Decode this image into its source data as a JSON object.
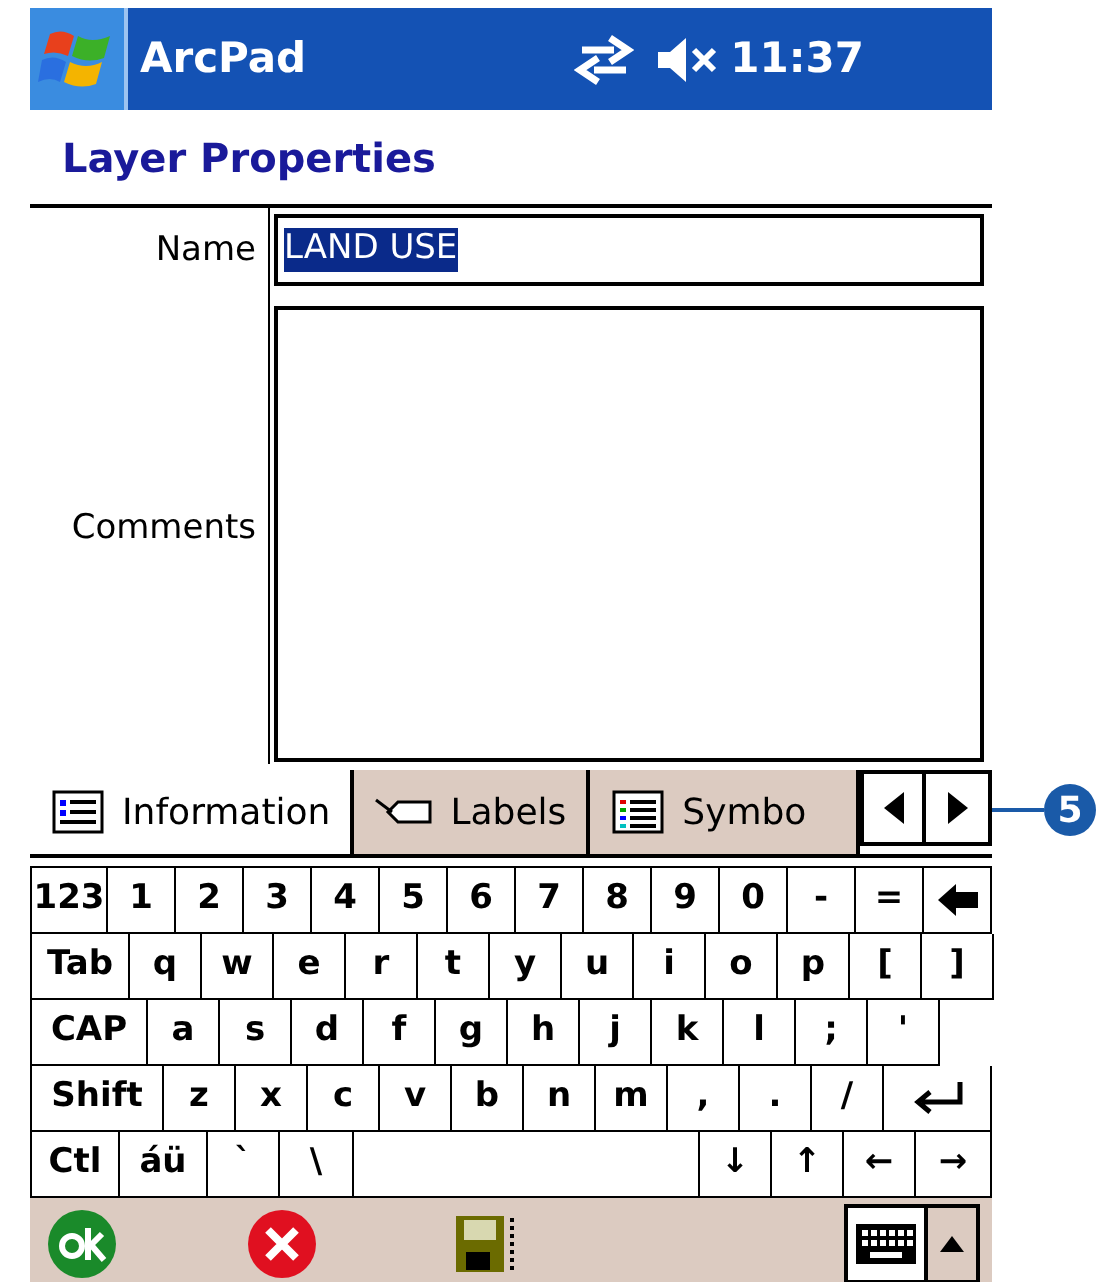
{
  "status_bar": {
    "app": "ArcPad",
    "time": "11:37"
  },
  "title": "Layer Properties",
  "fields": {
    "name_label": "Name",
    "name_value": "LAND USE",
    "name_selected": true,
    "comments_label": "Comments"
  },
  "tabs": [
    {
      "label": "Information",
      "kind": "info",
      "selected": true
    },
    {
      "label": "Labels",
      "kind": "label",
      "selected": false
    },
    {
      "label": "Symbo",
      "kind": "symbology",
      "selected": false
    }
  ],
  "callout": "5",
  "keyboard": [
    [
      {
        "kind": "key",
        "text": "123"
      },
      {
        "kind": "key",
        "text": "1"
      },
      {
        "kind": "key",
        "text": "2"
      },
      {
        "kind": "key",
        "text": "3"
      },
      {
        "kind": "key",
        "text": "4"
      },
      {
        "kind": "key",
        "text": "5"
      },
      {
        "kind": "key",
        "text": "6"
      },
      {
        "kind": "key",
        "text": "7"
      },
      {
        "kind": "key",
        "text": "8"
      },
      {
        "kind": "key",
        "text": "9"
      },
      {
        "kind": "key",
        "text": "0"
      },
      {
        "kind": "key",
        "text": "-"
      },
      {
        "kind": "key",
        "text": "="
      },
      {
        "kind": "backspace"
      }
    ],
    [
      {
        "kind": "key",
        "text": "Tab"
      },
      {
        "kind": "key",
        "text": "q"
      },
      {
        "kind": "key",
        "text": "w"
      },
      {
        "kind": "key",
        "text": "e"
      },
      {
        "kind": "key",
        "text": "r"
      },
      {
        "kind": "key",
        "text": "t"
      },
      {
        "kind": "key",
        "text": "y"
      },
      {
        "kind": "key",
        "text": "u"
      },
      {
        "kind": "key",
        "text": "i"
      },
      {
        "kind": "key",
        "text": "o"
      },
      {
        "kind": "key",
        "text": "p"
      },
      {
        "kind": "key",
        "text": "["
      },
      {
        "kind": "key",
        "text": "]"
      }
    ],
    [
      {
        "kind": "key",
        "text": "CAP"
      },
      {
        "kind": "key",
        "text": "a"
      },
      {
        "kind": "key",
        "text": "s"
      },
      {
        "kind": "key",
        "text": "d"
      },
      {
        "kind": "key",
        "text": "f"
      },
      {
        "kind": "key",
        "text": "g"
      },
      {
        "kind": "key",
        "text": "h"
      },
      {
        "kind": "key",
        "text": "j"
      },
      {
        "kind": "key",
        "text": "k"
      },
      {
        "kind": "key",
        "text": "l"
      },
      {
        "kind": "key",
        "text": ";"
      },
      {
        "kind": "key",
        "text": "'"
      },
      {
        "kind": "blank"
      }
    ],
    [
      {
        "kind": "key",
        "text": "Shift"
      },
      {
        "kind": "key",
        "text": "z"
      },
      {
        "kind": "key",
        "text": "x"
      },
      {
        "kind": "key",
        "text": "c"
      },
      {
        "kind": "key",
        "text": "v"
      },
      {
        "kind": "key",
        "text": "b"
      },
      {
        "kind": "key",
        "text": "n"
      },
      {
        "kind": "key",
        "text": "m"
      },
      {
        "kind": "key",
        "text": ","
      },
      {
        "kind": "key",
        "text": "."
      },
      {
        "kind": "key",
        "text": "/"
      },
      {
        "kind": "enter"
      }
    ],
    [
      {
        "kind": "key",
        "text": "Ctl"
      },
      {
        "kind": "key",
        "text": "áü"
      },
      {
        "kind": "key",
        "text": "`"
      },
      {
        "kind": "key",
        "text": "\\"
      },
      {
        "kind": "space"
      },
      {
        "kind": "key",
        "text": "↓"
      },
      {
        "kind": "key",
        "text": "↑"
      },
      {
        "kind": "key",
        "text": "←"
      },
      {
        "kind": "key",
        "text": "→"
      }
    ]
  ]
}
